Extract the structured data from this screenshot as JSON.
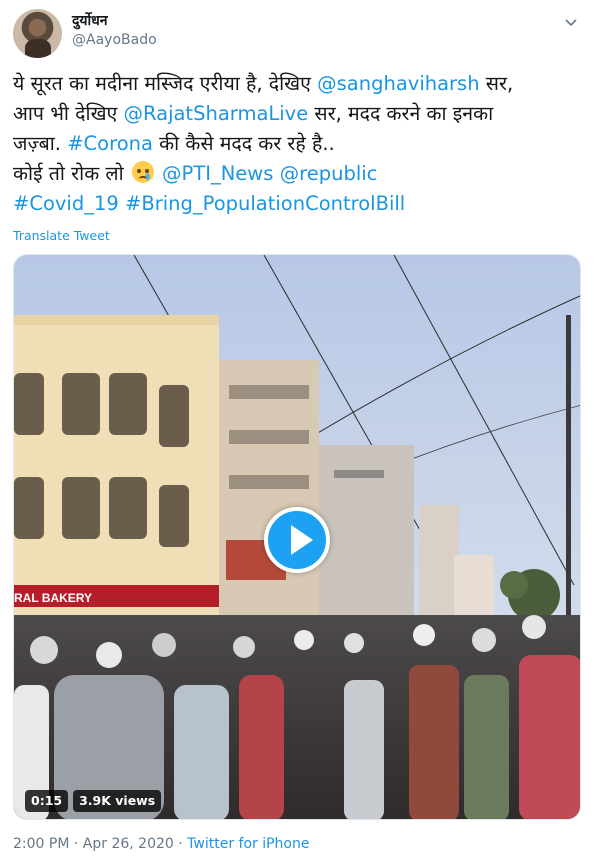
{
  "author": {
    "display_name": "दुर्योधन",
    "handle": "@AayoBado",
    "avatar_icon": "user-avatar",
    "menu_icon": "chevron-down-icon"
  },
  "tweet": {
    "line1_plain": "ये सूरत का मदीना मस्जिद एरीया है, देखिए ",
    "line1_mention": "@sanghaviharsh",
    "line1_end": " सर,",
    "line2_start": "आप भी देखिए ",
    "line2_mention": "@RajatSharmaLive",
    "line2_end": " सर, मदद करने का इनका",
    "line3_start": "जज़्बा. ",
    "line3_hashtag": "#Corona",
    "line3_end": " की कैसे मदद कर रहे है..",
    "line4_start": "कोई तो रोक लो ",
    "line4_emoji": "crying-face-emoji",
    "line4_mention1": "@PTI_News",
    "line4_space": " ",
    "line4_mention2": "@republic",
    "line5_hashtag1": "#Covid_19",
    "line5_space": " ",
    "line5_hashtag2": "#Bring_PopulationControlBill"
  },
  "translate_label": "Translate Tweet",
  "media": {
    "sign_text": "RAL BAKERY",
    "duration": "0:15",
    "views": "3.9K views",
    "play_icon": "play-icon"
  },
  "footer": {
    "time": "2:00 PM",
    "separator": " · ",
    "date": "Apr 26, 2020",
    "source": "Twitter for iPhone"
  },
  "colors": {
    "link": "#1b95e0",
    "play_button": "#1da1f2",
    "secondary_text": "#657786"
  }
}
